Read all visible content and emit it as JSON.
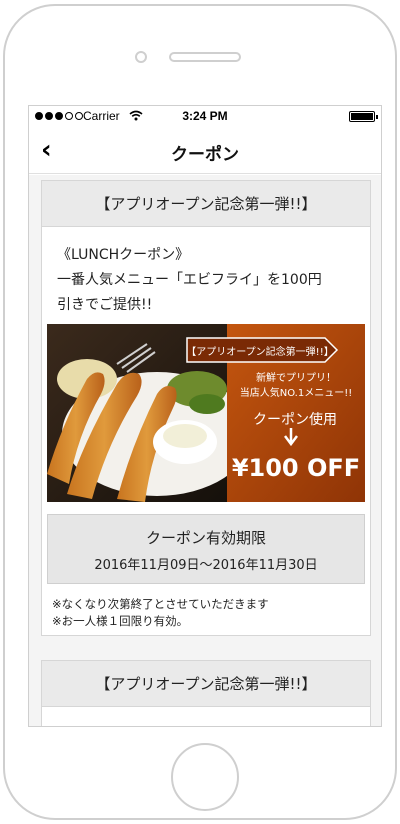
{
  "status_bar": {
    "carrier": "Carrier",
    "time": "3:24 PM",
    "signal_bars_filled": 3,
    "signal_bars_total": 5
  },
  "nav": {
    "back_icon": "chevron-left-icon",
    "title": "クーポン"
  },
  "coupons": [
    {
      "header": "【アプリオープン記念第一弾!!】",
      "description_lines": [
        "《LUNCHクーポン》",
        "一番人気メニュー「エビフライ」を100円",
        "引きでご提供!!"
      ],
      "image": {
        "banner": "【アプリオープン記念第一弾!!】",
        "tagline_1": "新鮮でプリプリ！",
        "tagline_2": "当店人気NO.1メニュー!!",
        "use_label": "クーポン使用",
        "discount": "¥100 OFF"
      },
      "validity": {
        "title": "クーポン有効期限",
        "dates": "2016年11月09日〜2016年11月30日"
      },
      "notes": [
        "※なくなり次第終了とさせていただきます",
        "※お一人様１回限り有効。"
      ]
    },
    {
      "header": "【アプリオープン記念第一弾!!】"
    }
  ],
  "colors": {
    "promo_orange": "#b5460c",
    "header_gray": "#eaeaea"
  }
}
